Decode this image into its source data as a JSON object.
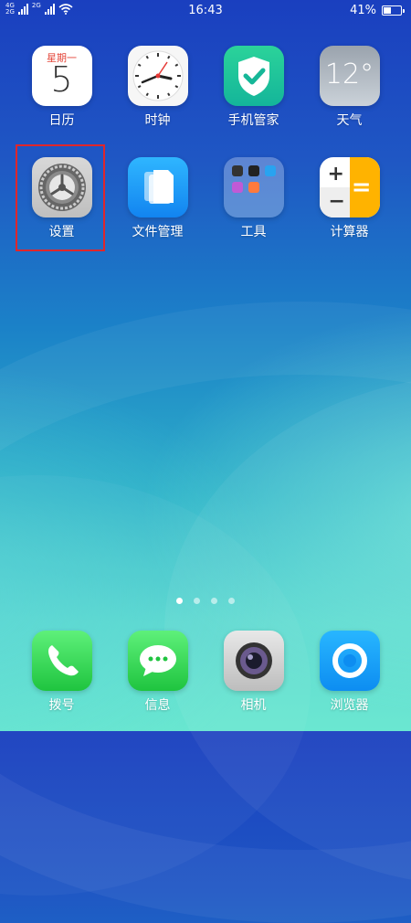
{
  "status_bar": {
    "network_top": "4G",
    "network_bottom": "2G",
    "network2_top": "2G",
    "time": "16:43",
    "battery_percent": "41%",
    "battery_level": 0.41
  },
  "apps_row1": [
    {
      "label": "日历",
      "icon": "calendar-icon",
      "weekday": "星期一",
      "day": "5"
    },
    {
      "label": "时钟",
      "icon": "clock-icon"
    },
    {
      "label": "手机管家",
      "icon": "phone-manager-shield-icon"
    },
    {
      "label": "天气",
      "icon": "weather-icon",
      "temp": "12°"
    }
  ],
  "apps_row2": [
    {
      "label": "设置",
      "icon": "settings-gear-icon"
    },
    {
      "label": "文件管理",
      "icon": "file-manager-icon"
    },
    {
      "label": "工具",
      "icon": "tools-folder-icon"
    },
    {
      "label": "计算器",
      "icon": "calculator-icon"
    }
  ],
  "pagination": {
    "count": 4,
    "active_index": 0
  },
  "dock": [
    {
      "label": "拨号",
      "icon": "phone-icon"
    },
    {
      "label": "信息",
      "icon": "messages-icon"
    },
    {
      "label": "相机",
      "icon": "camera-icon"
    },
    {
      "label": "浏览器",
      "icon": "browser-icon"
    }
  ],
  "highlight": {
    "target": "设置",
    "color": "#e0262b"
  }
}
